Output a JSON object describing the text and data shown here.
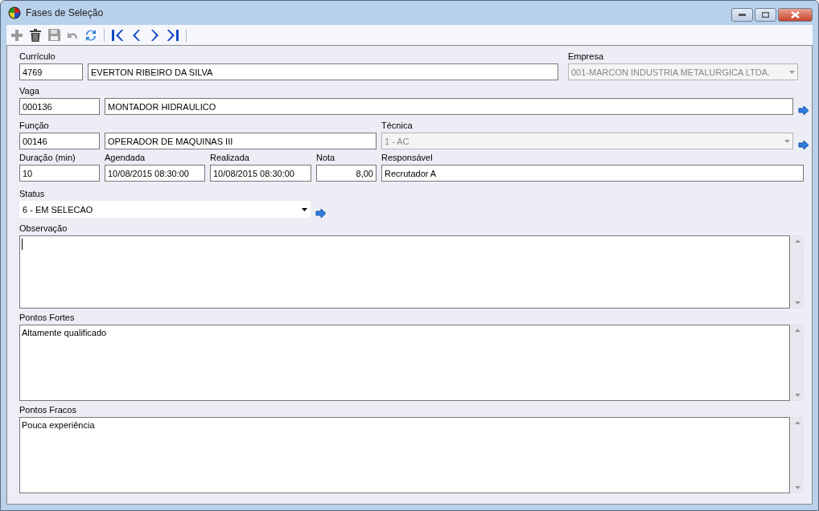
{
  "window": {
    "title": "Fases de Seleção"
  },
  "toolbar": [
    {
      "kind": "add",
      "disabled": true
    },
    {
      "kind": "delete",
      "disabled": false
    },
    {
      "kind": "save",
      "disabled": true
    },
    {
      "kind": "undo",
      "disabled": true
    },
    {
      "kind": "refresh",
      "disabled": false
    },
    {
      "kind": "separator"
    },
    {
      "kind": "first",
      "disabled": false
    },
    {
      "kind": "prev",
      "disabled": false
    },
    {
      "kind": "next",
      "disabled": false
    },
    {
      "kind": "last",
      "disabled": false
    },
    {
      "kind": "separator"
    }
  ],
  "curriculo": {
    "label": "Currículo",
    "code": "4769",
    "name": "EVERTON RIBEIRO DA SILVA"
  },
  "empresa": {
    "label": "Empresa",
    "value": "001-MARCON INDUSTRIA METALURGICA LTDA.",
    "disabled": true
  },
  "vaga": {
    "label": "Vaga",
    "code": "000136",
    "name": "MONTADOR HIDRAULICO"
  },
  "funcao": {
    "label": "Função",
    "code": "00146",
    "name": "OPERADOR DE MAQUINAS III"
  },
  "tecnica": {
    "label": "Técnica",
    "value": "1 - AC",
    "disabled": true
  },
  "duracao": {
    "label": "Duração (min)",
    "value": "10"
  },
  "agendada": {
    "label": "Agendada",
    "value": "10/08/2015 08:30:00"
  },
  "realizada": {
    "label": "Realizada",
    "value": "10/08/2015 08:30:00"
  },
  "nota": {
    "label": "Nota",
    "value": "8,00"
  },
  "responsavel": {
    "label": "Responsável",
    "value": "Recrutador A"
  },
  "status": {
    "label": "Status",
    "value": "6 - EM SELECAO",
    "disabled": false
  },
  "memos": [
    {
      "label": "Observação",
      "focused": true
    },
    {
      "label": "Pontos Fortes",
      "value": "Altamente qualificado",
      "focused": false
    },
    {
      "label": "Pontos Fracos",
      "value": "Pouca experiência",
      "focused": false
    }
  ]
}
